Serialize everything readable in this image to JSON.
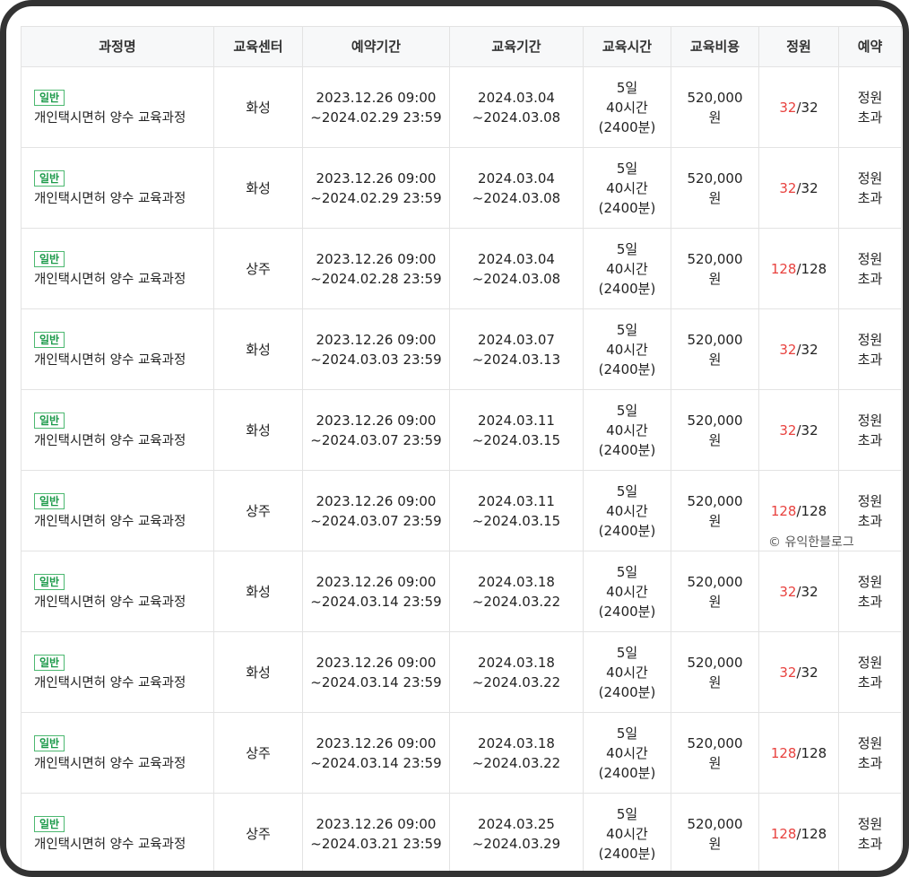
{
  "table": {
    "headers": [
      "과정명",
      "교육센터",
      "예약기간",
      "교육기간",
      "교육시간",
      "교육비용",
      "정원",
      "예약"
    ],
    "rows": [
      {
        "badge": "일반",
        "course": "개인택시면허 양수 교육과정",
        "center": "화성",
        "reserve_start": "2023.12.26 09:00",
        "reserve_end": "~2024.02.29 23:59",
        "edu_start": "2024.03.04",
        "edu_end": "~2024.03.08",
        "time_days": "5일",
        "time_hours": "40시간",
        "time_minutes": "(2400분)",
        "cost": "520,000",
        "cost_unit": "원",
        "capacity_current": "32",
        "capacity_sep": "/",
        "capacity_total": "32",
        "status_1": "정원",
        "status_2": "초과"
      },
      {
        "badge": "일반",
        "course": "개인택시면허 양수 교육과정",
        "center": "화성",
        "reserve_start": "2023.12.26 09:00",
        "reserve_end": "~2024.02.29 23:59",
        "edu_start": "2024.03.04",
        "edu_end": "~2024.03.08",
        "time_days": "5일",
        "time_hours": "40시간",
        "time_minutes": "(2400분)",
        "cost": "520,000",
        "cost_unit": "원",
        "capacity_current": "32",
        "capacity_sep": "/",
        "capacity_total": "32",
        "status_1": "정원",
        "status_2": "초과"
      },
      {
        "badge": "일반",
        "course": "개인택시면허 양수 교육과정",
        "center": "상주",
        "reserve_start": "2023.12.26 09:00",
        "reserve_end": "~2024.02.28 23:59",
        "edu_start": "2024.03.04",
        "edu_end": "~2024.03.08",
        "time_days": "5일",
        "time_hours": "40시간",
        "time_minutes": "(2400분)",
        "cost": "520,000",
        "cost_unit": "원",
        "capacity_current": "128",
        "capacity_sep": "/",
        "capacity_total": "128",
        "status_1": "정원",
        "status_2": "초과"
      },
      {
        "badge": "일반",
        "course": "개인택시면허 양수 교육과정",
        "center": "화성",
        "reserve_start": "2023.12.26 09:00",
        "reserve_end": "~2024.03.03 23:59",
        "edu_start": "2024.03.07",
        "edu_end": "~2024.03.13",
        "time_days": "5일",
        "time_hours": "40시간",
        "time_minutes": "(2400분)",
        "cost": "520,000",
        "cost_unit": "원",
        "capacity_current": "32",
        "capacity_sep": "/",
        "capacity_total": "32",
        "status_1": "정원",
        "status_2": "초과"
      },
      {
        "badge": "일반",
        "course": "개인택시면허 양수 교육과정",
        "center": "화성",
        "reserve_start": "2023.12.26 09:00",
        "reserve_end": "~2024.03.07 23:59",
        "edu_start": "2024.03.11",
        "edu_end": "~2024.03.15",
        "time_days": "5일",
        "time_hours": "40시간",
        "time_minutes": "(2400분)",
        "cost": "520,000",
        "cost_unit": "원",
        "capacity_current": "32",
        "capacity_sep": "/",
        "capacity_total": "32",
        "status_1": "정원",
        "status_2": "초과"
      },
      {
        "badge": "일반",
        "course": "개인택시면허 양수 교육과정",
        "center": "상주",
        "reserve_start": "2023.12.26 09:00",
        "reserve_end": "~2024.03.07 23:59",
        "edu_start": "2024.03.11",
        "edu_end": "~2024.03.15",
        "time_days": "5일",
        "time_hours": "40시간",
        "time_minutes": "(2400분)",
        "cost": "520,000",
        "cost_unit": "원",
        "capacity_current": "128",
        "capacity_sep": "/",
        "capacity_total": "128",
        "status_1": "정원",
        "status_2": "초과"
      },
      {
        "badge": "일반",
        "course": "개인택시면허 양수 교육과정",
        "center": "화성",
        "reserve_start": "2023.12.26 09:00",
        "reserve_end": "~2024.03.14 23:59",
        "edu_start": "2024.03.18",
        "edu_end": "~2024.03.22",
        "time_days": "5일",
        "time_hours": "40시간",
        "time_minutes": "(2400분)",
        "cost": "520,000",
        "cost_unit": "원",
        "capacity_current": "32",
        "capacity_sep": "/",
        "capacity_total": "32",
        "status_1": "정원",
        "status_2": "초과"
      },
      {
        "badge": "일반",
        "course": "개인택시면허 양수 교육과정",
        "center": "화성",
        "reserve_start": "2023.12.26 09:00",
        "reserve_end": "~2024.03.14 23:59",
        "edu_start": "2024.03.18",
        "edu_end": "~2024.03.22",
        "time_days": "5일",
        "time_hours": "40시간",
        "time_minutes": "(2400분)",
        "cost": "520,000",
        "cost_unit": "원",
        "capacity_current": "32",
        "capacity_sep": "/",
        "capacity_total": "32",
        "status_1": "정원",
        "status_2": "초과"
      },
      {
        "badge": "일반",
        "course": "개인택시면허 양수 교육과정",
        "center": "상주",
        "reserve_start": "2023.12.26 09:00",
        "reserve_end": "~2024.03.14 23:59",
        "edu_start": "2024.03.18",
        "edu_end": "~2024.03.22",
        "time_days": "5일",
        "time_hours": "40시간",
        "time_minutes": "(2400분)",
        "cost": "520,000",
        "cost_unit": "원",
        "capacity_current": "128",
        "capacity_sep": "/",
        "capacity_total": "128",
        "status_1": "정원",
        "status_2": "초과"
      },
      {
        "badge": "일반",
        "course": "개인택시면허 양수 교육과정",
        "center": "상주",
        "reserve_start": "2023.12.26 09:00",
        "reserve_end": "~2024.03.21 23:59",
        "edu_start": "2024.03.25",
        "edu_end": "~2024.03.29",
        "time_days": "5일",
        "time_hours": "40시간",
        "time_minutes": "(2400분)",
        "cost": "520,000",
        "cost_unit": "원",
        "capacity_current": "128",
        "capacity_sep": "/",
        "capacity_total": "128",
        "status_1": "정원",
        "status_2": "초과"
      }
    ]
  },
  "watermark": "© 유익한블로그",
  "colors": {
    "full_capacity": "#e8423f",
    "badge_green": "#1c9a4a",
    "frame": "#333333"
  }
}
